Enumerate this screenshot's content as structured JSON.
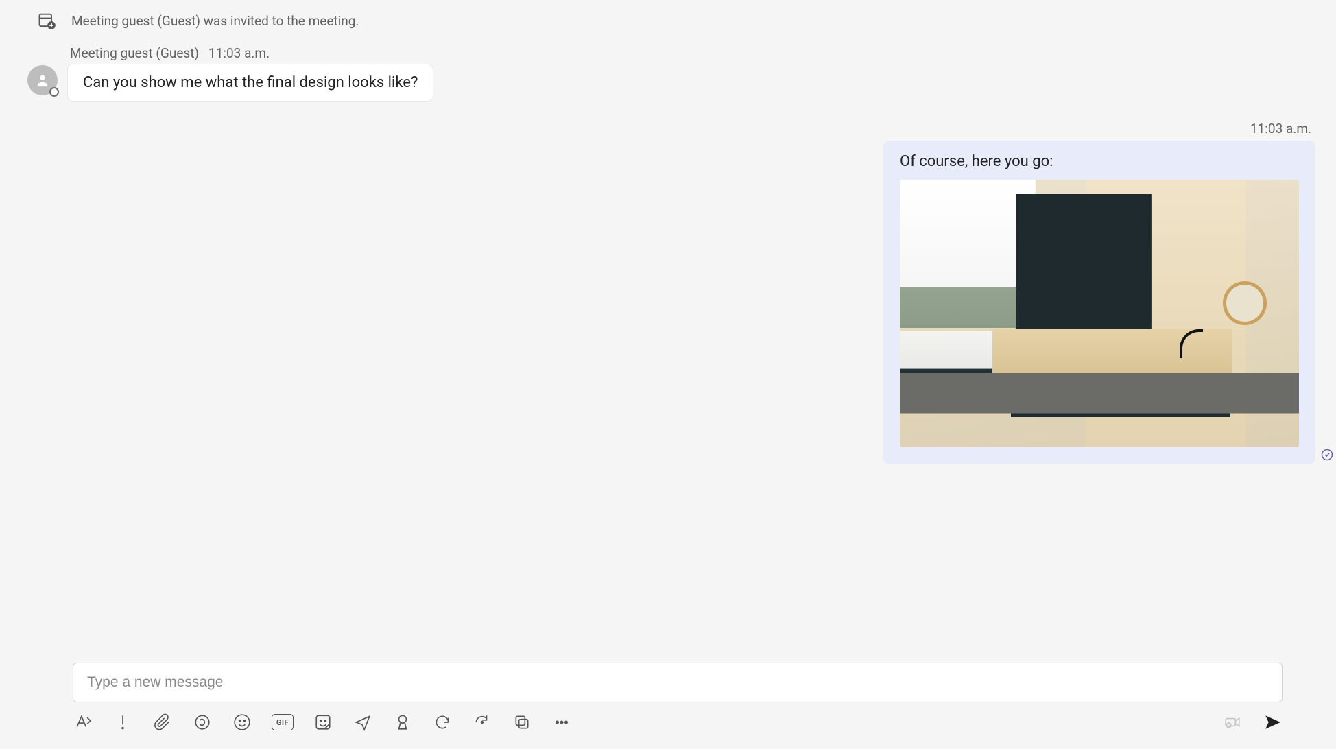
{
  "system": {
    "text": "Meeting guest (Guest) was invited to the meeting."
  },
  "guest_message": {
    "sender": "Meeting guest (Guest)",
    "time": "11:03 a.m.",
    "text": "Can you show me what the final design looks like?"
  },
  "self_message": {
    "time": "11:03 a.m.",
    "text": "Of course, here you go:",
    "attachment_desc": "kitchen-design-image"
  },
  "compose": {
    "placeholder": "Type a new message",
    "value": ""
  },
  "toolbar": {
    "gif_label": "GIF"
  },
  "colors": {
    "self_bubble": "#e8ebfa",
    "accent": "#6264a7"
  }
}
